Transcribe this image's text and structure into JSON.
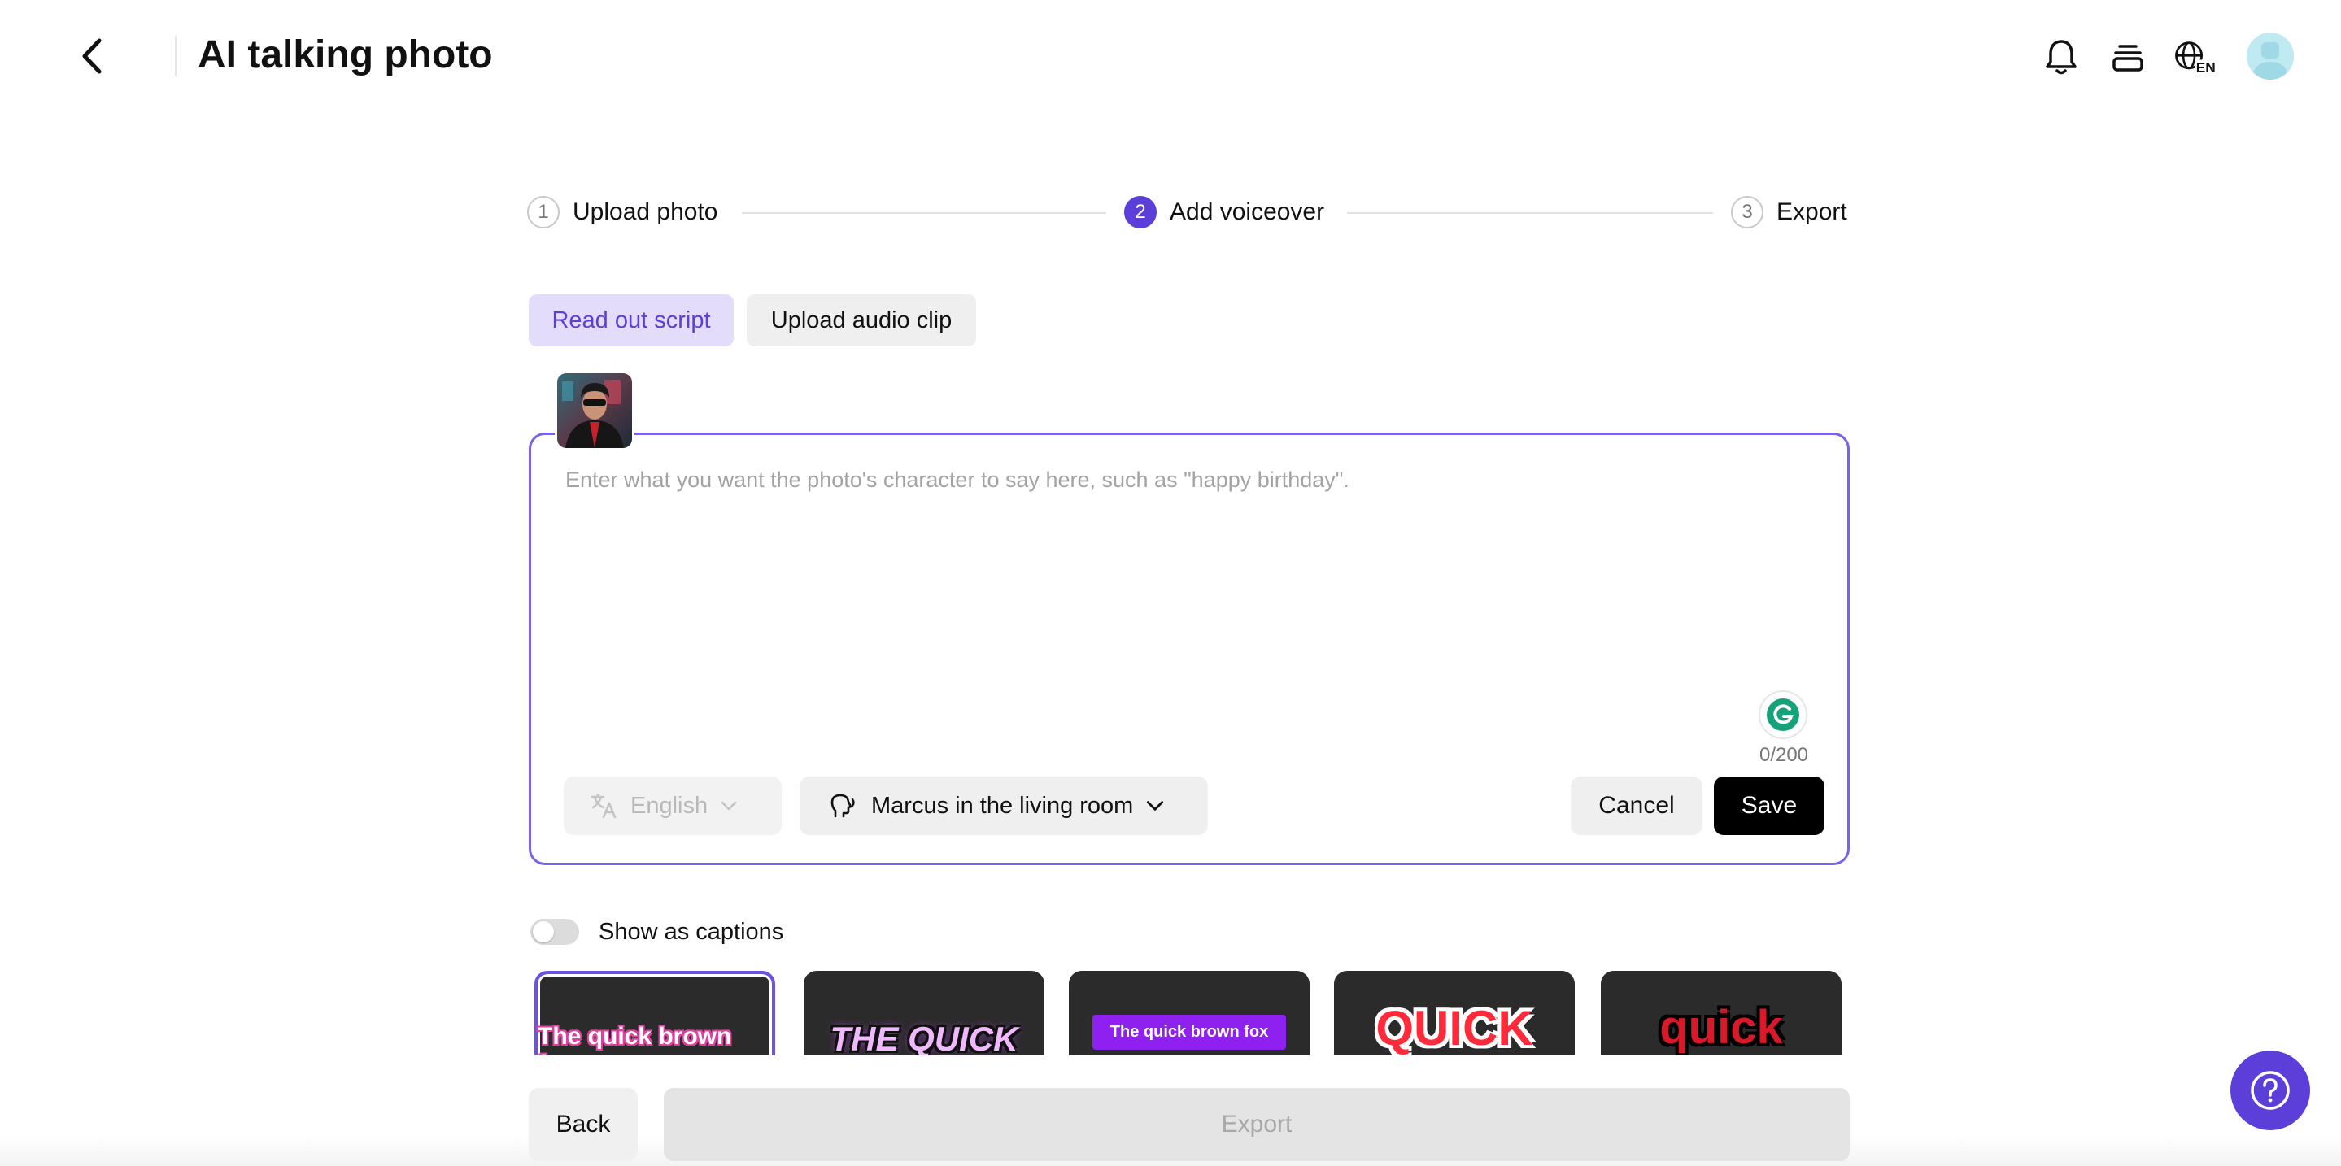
{
  "header": {
    "title": "AI talking photo",
    "language_badge": "EN"
  },
  "stepper": {
    "steps": [
      {
        "number": "1",
        "label": "Upload photo",
        "state": "done"
      },
      {
        "number": "2",
        "label": "Add voiceover",
        "state": "active"
      },
      {
        "number": "3",
        "label": "Export",
        "state": "pending"
      }
    ]
  },
  "tabs": {
    "read_script": "Read out script",
    "upload_audio": "Upload audio clip",
    "active": "read_script"
  },
  "script": {
    "placeholder": "Enter what you want the photo's character to say here, such as \"happy birthday\".",
    "value": "",
    "char_count": "0/200",
    "language": "English",
    "voice": "Marcus in the living room",
    "cancel_label": "Cancel",
    "save_label": "Save"
  },
  "captions": {
    "toggle_label": "Show as captions",
    "enabled": false,
    "styles": [
      {
        "text": "The quick brown fox",
        "selected": true
      },
      {
        "text": "THE QUICK",
        "selected": false
      },
      {
        "text": "The quick brown fox",
        "selected": false
      },
      {
        "text": "QUICK",
        "selected": false
      },
      {
        "text": "quick",
        "selected": false
      }
    ]
  },
  "footer": {
    "back_label": "Back",
    "export_label": "Export"
  },
  "colors": {
    "accent": "#5b3fd8",
    "accent_light": "#e3dcfb",
    "card_border": "#7b62e6"
  },
  "icons": {
    "back": "chevron-left-icon",
    "notifications": "bell-icon",
    "projects": "stack-icon",
    "language": "globe-icon",
    "translate": "translate-icon",
    "voice": "voice-head-icon",
    "help": "question-mark-icon",
    "grammarly": "grammarly-icon"
  }
}
